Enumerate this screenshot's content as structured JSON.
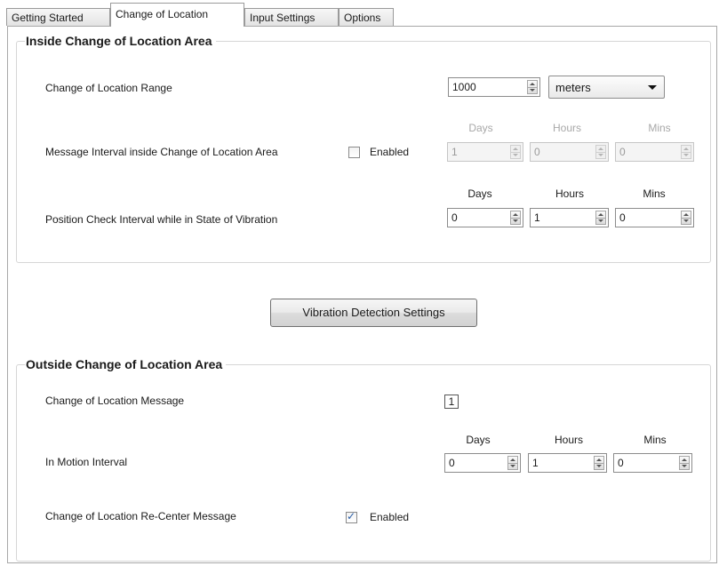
{
  "tabs": [
    "Getting Started",
    "Change of Location",
    "Input Settings",
    "Options"
  ],
  "columns": {
    "days": "Days",
    "hours": "Hours",
    "mins": "Mins"
  },
  "inside": {
    "title": "Inside Change of Location Area",
    "range": {
      "label": "Change of Location Range",
      "value": "1000",
      "unit": "meters"
    },
    "message_interval": {
      "label": "Message Interval inside Change of Location Area",
      "enabled_label": "Enabled",
      "enabled": false,
      "days": "1",
      "hours": "0",
      "mins": "0"
    },
    "position_check": {
      "label": "Position Check Interval while in State of Vibration",
      "days": "0",
      "hours": "1",
      "mins": "0"
    }
  },
  "vibration_button": "Vibration Detection Settings",
  "outside": {
    "title": "Outside Change of Location Area",
    "message": {
      "label": "Change of Location Message",
      "value": "1"
    },
    "motion_interval": {
      "label": "In Motion Interval",
      "days": "0",
      "hours": "1",
      "mins": "0"
    },
    "recenter": {
      "label": "Change of Location Re-Center Message",
      "enabled_label": "Enabled",
      "enabled": true,
      "check": "✓"
    }
  },
  "colors": {
    "accent": "#2b5fa8",
    "border": "#a8a8a8",
    "disabled_text": "#a8a8a8"
  }
}
